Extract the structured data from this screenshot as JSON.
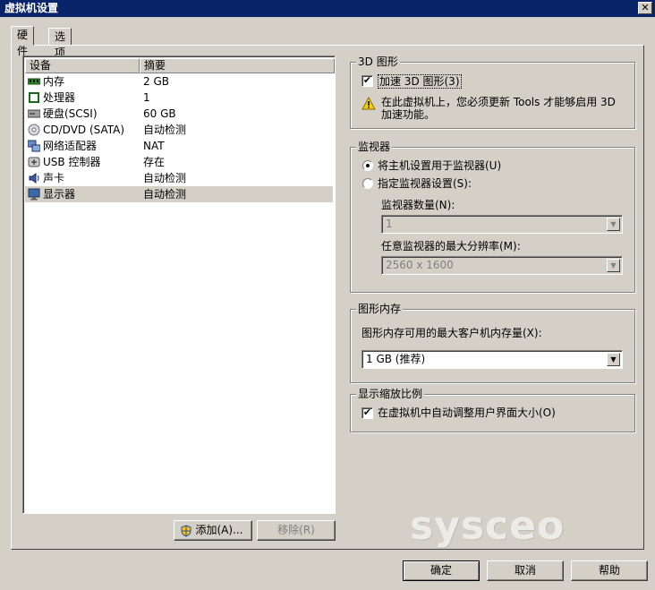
{
  "window": {
    "title": "虚拟机设置",
    "close_glyph": "✕"
  },
  "tabs": [
    {
      "label": "硬件"
    },
    {
      "label": "选项"
    }
  ],
  "device_list": {
    "header_device": "设备",
    "header_summary": "摘要",
    "rows": [
      {
        "name": "内存",
        "summary": "2 GB",
        "icon": "memory-icon"
      },
      {
        "name": "处理器",
        "summary": "1",
        "icon": "processor-icon"
      },
      {
        "name": "硬盘(SCSI)",
        "summary": "60 GB",
        "icon": "hard-disk-icon"
      },
      {
        "name": "CD/DVD (SATA)",
        "summary": "自动检测",
        "icon": "cd-dvd-icon"
      },
      {
        "name": "网络适配器",
        "summary": "NAT",
        "icon": "network-adapter-icon"
      },
      {
        "name": "USB 控制器",
        "summary": "存在",
        "icon": "usb-icon"
      },
      {
        "name": "声卡",
        "summary": "自动检测",
        "icon": "sound-card-icon"
      },
      {
        "name": "显示器",
        "summary": "自动检测",
        "icon": "display-icon",
        "selected": true
      }
    ]
  },
  "list_buttons": {
    "add": "添加(A)...",
    "remove": "移除(R)"
  },
  "graphics_3d": {
    "title": "3D 图形",
    "accelerate_label": "加速 3D 图形(3)",
    "accelerate_checked": true,
    "warning_line1": "在此虚拟机上，您必须更新 Tools 才能够启用 3D",
    "warning_line2": "加速功能。"
  },
  "monitors": {
    "title": "监视器",
    "use_host_label": "将主机设置用于监视器(U)",
    "specify_label": "指定监视器设置(S):",
    "selected_option": "use_host",
    "count_label": "监视器数量(N):",
    "count_value": "1",
    "max_res_label": "任意监视器的最大分辨率(M):",
    "max_res_value": "2560 x 1600"
  },
  "graphics_memory": {
    "title": "图形内存",
    "max_label": "图形内存可用的最大客户机内存量(X):",
    "value": "1 GB (推荐)"
  },
  "display_scaling": {
    "title": "显示缩放比例",
    "auto_adjust_label": "在虚拟机中自动调整用户界面大小(O)",
    "auto_adjust_checked": true
  },
  "footer": {
    "ok": "确定",
    "cancel": "取消",
    "help": "帮助"
  },
  "watermark": "sysceo"
}
